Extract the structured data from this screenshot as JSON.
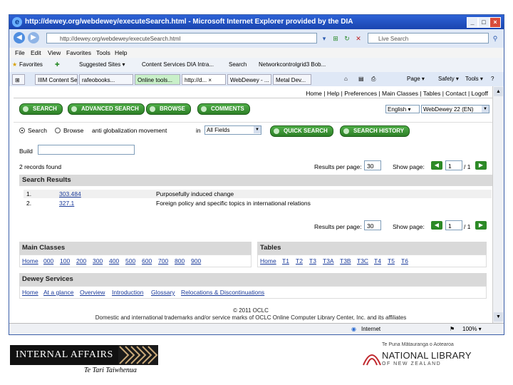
{
  "window": {
    "title": "http://dewey.org/webdewey/executeSearch.html - Microsoft Internet Explorer provided by the DIA",
    "min_label": "_",
    "max_label": "□",
    "close_label": "×"
  },
  "address": {
    "url": "http://dewey.org/webdewey/executeSearch.html",
    "live_search_placeholder": "Live Search"
  },
  "menu": [
    "File",
    "Edit",
    "View",
    "Favorites",
    "Tools",
    "Help"
  ],
  "favorites": [
    {
      "label": "Favorites"
    },
    {
      "label": "Suggested Sites ▾"
    },
    {
      "label": "Content Services DIA Intra..."
    },
    {
      "label": "Search"
    },
    {
      "label": "Networkcontrolgrid3 Bob..."
    }
  ],
  "tabs": [
    {
      "label": "IIIM Content Se..."
    },
    {
      "label": "rafeobooks..."
    },
    {
      "label": "Online tools..."
    },
    {
      "label": "http://d... ×"
    },
    {
      "label": "WebDewey - ..."
    },
    {
      "label": "Metal Dev..."
    }
  ],
  "tab_tools": {
    "page": "Page ▾",
    "safety": "Safety ▾",
    "tools": "Tools ▾",
    "help": "?"
  },
  "toplinks": "Home | Help | Preferences | Main Classes | Tables | Contact | Logoff",
  "buttons": {
    "search": "SEARCH",
    "advanced": "ADVANCED SEARCH",
    "browse": "BROWSE",
    "comments": "COMMENTS",
    "quick_search": "QUICK SEARCH",
    "search_history": "SEARCH HISTORY"
  },
  "language_select": "English ▾",
  "edition_select": "WebDewey 22 (EN)",
  "search_form": {
    "radio_search": "Search",
    "radio_browse": "Browse",
    "query": "anti globalization movement",
    "in_label": "in",
    "field_select": "All Fields",
    "build_label": "Build"
  },
  "results": {
    "found": "2 records found",
    "per_page_label": "Results per page:",
    "per_page": "30",
    "show_page_label": "Show page:",
    "page": "1",
    "of_pages": "/ 1",
    "header": "Search Results",
    "rows": [
      {
        "num": "1.",
        "code": "303.484",
        "caption": "Purposefully induced change"
      },
      {
        "num": "2.",
        "code": "327.1",
        "caption": "Foreign policy and specific topics in international relations"
      }
    ]
  },
  "main_classes": {
    "header": "Main Classes",
    "links": [
      "Home",
      "000",
      "100",
      "200",
      "300",
      "400",
      "500",
      "600",
      "700",
      "800",
      "900"
    ]
  },
  "tables": {
    "header": "Tables",
    "links": [
      "Home",
      "T1",
      "T2",
      "T3",
      "T3A",
      "T3B",
      "T3C",
      "T4",
      "T5",
      "T6"
    ]
  },
  "dewey_services": {
    "header": "Dewey Services",
    "links": [
      "Home",
      "At a glance",
      "Overview",
      "Introduction",
      "Glossary",
      "Relocations & Discontinuations"
    ]
  },
  "footer": {
    "copyright": "© 2011 OCLC",
    "trademark": "Domestic and international trademarks and/or service marks of OCLC Online Computer Library Center, Inc. and its affiliates"
  },
  "statusbar": {
    "zone": "Internet",
    "zoom": "100% ▾"
  },
  "branding": {
    "internal_affairs": "INTERNAL AFFAIRS",
    "te_tari": "Te Tari Taiwhenua",
    "te_puna": "Te Puna Mātauranga o Aotearoa",
    "national_library": "NATIONAL LIBRARY",
    "of_nz": "OF NEW ZEALAND"
  },
  "colors": {
    "ie_title": "#2d62d6",
    "button_green": "#3a9a32",
    "section_gray": "#d9d9d9",
    "link_blue": "#1a3a9a"
  }
}
